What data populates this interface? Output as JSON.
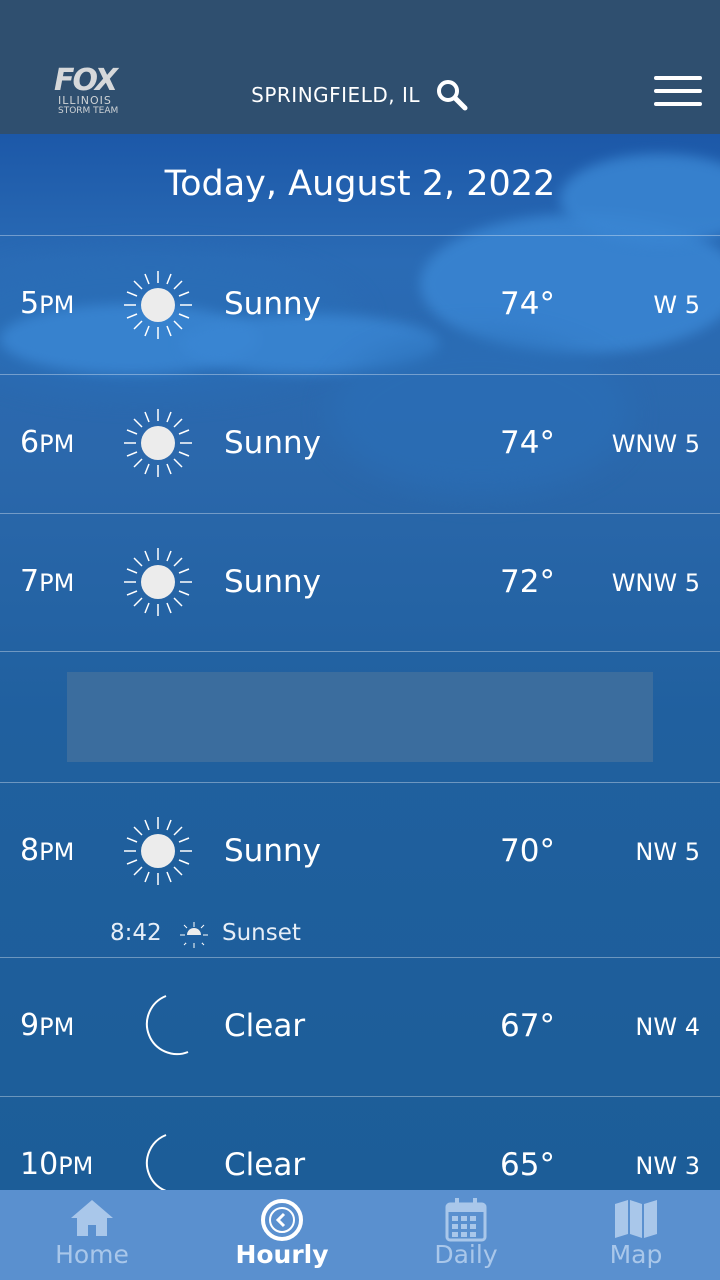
{
  "header": {
    "logo_main": "FOX",
    "logo_sub1": "ILLINOIS",
    "logo_sub2": "STORM TEAM",
    "location": "SPRINGFIELD, IL"
  },
  "date_label": "Today, August 2, 2022",
  "hours": [
    {
      "hour": "5",
      "ampm": "PM",
      "icon": "sun-icon",
      "condition": "Sunny",
      "temp": "74°",
      "wind": "W 5"
    },
    {
      "hour": "6",
      "ampm": "PM",
      "icon": "sun-icon",
      "condition": "Sunny",
      "temp": "74°",
      "wind": "WNW 5"
    },
    {
      "hour": "7",
      "ampm": "PM",
      "icon": "sun-icon",
      "condition": "Sunny",
      "temp": "72°",
      "wind": "WNW 5"
    },
    {
      "hour": "8",
      "ampm": "PM",
      "icon": "sun-icon",
      "condition": "Sunny",
      "temp": "70°",
      "wind": "NW 5"
    },
    {
      "hour": "9",
      "ampm": "PM",
      "icon": "moon-icon",
      "condition": "Clear",
      "temp": "67°",
      "wind": "NW 4"
    },
    {
      "hour": "10",
      "ampm": "PM",
      "icon": "moon-icon",
      "condition": "Clear",
      "temp": "65°",
      "wind": "NW 3"
    }
  ],
  "sunset": {
    "time": "8:42",
    "label": "Sunset"
  },
  "tabs": [
    {
      "label": "Home",
      "icon": "home-icon",
      "active": false
    },
    {
      "label": "Hourly",
      "icon": "clock-icon",
      "active": true
    },
    {
      "label": "Daily",
      "icon": "calendar-icon",
      "active": false
    },
    {
      "label": "Map",
      "icon": "map-icon",
      "active": false
    }
  ],
  "colors": {
    "header_bg": "#2f4f6f",
    "tabbar_bg": "#5a90cf",
    "tab_inactive": "#a9c7ea"
  }
}
